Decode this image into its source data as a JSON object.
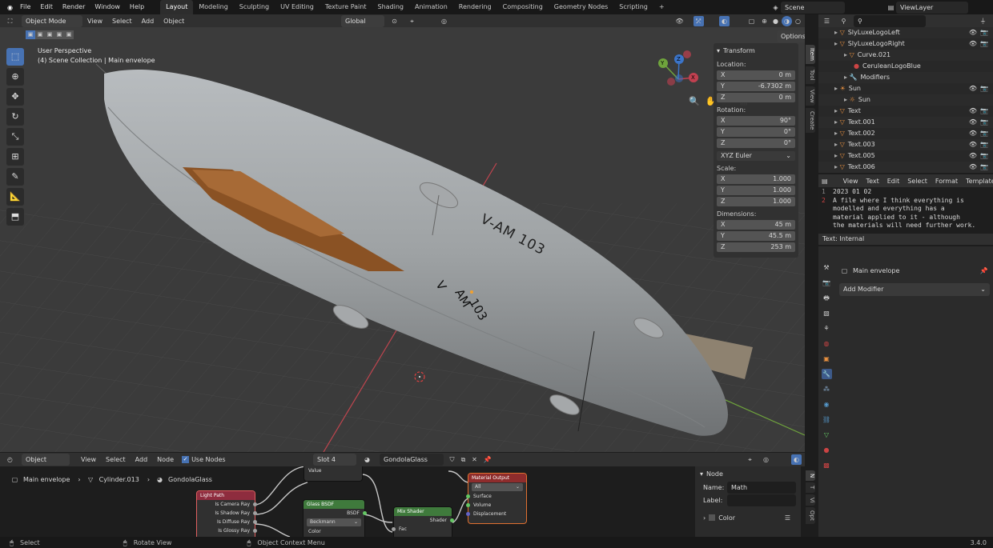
{
  "menu": {
    "items": [
      "File",
      "Edit",
      "Render",
      "Window",
      "Help"
    ],
    "workspaces": [
      "Layout",
      "Modeling",
      "Sculpting",
      "UV Editing",
      "Texture Paint",
      "Shading",
      "Animation",
      "Rendering",
      "Compositing",
      "Geometry Nodes",
      "Scripting"
    ],
    "active_workspace": "Layout",
    "add_tab": "+",
    "scene": "Scene",
    "view_layer": "ViewLayer"
  },
  "viewport_header": {
    "mode": "Object Mode",
    "menus": [
      "View",
      "Select",
      "Add",
      "Object"
    ],
    "orientation": "Global",
    "options": "Options"
  },
  "viewport": {
    "perspective": "User Perspective",
    "collection": "(4) Scene Collection | Main envelope",
    "hull_text_1": "V-AM 103",
    "hull_text_2_a": "V",
    "hull_text_2_b": "AM",
    "hull_text_2_c": "103",
    "gizmo": {
      "x": "X",
      "y": "Y",
      "z": "Z"
    }
  },
  "npanel": {
    "title": "Transform",
    "location_label": "Location:",
    "location": [
      {
        "axis": "X",
        "value": "0 m"
      },
      {
        "axis": "Y",
        "value": "-6.7302 m"
      },
      {
        "axis": "Z",
        "value": "0 m"
      }
    ],
    "rotation_label": "Rotation:",
    "rotation": [
      {
        "axis": "X",
        "value": "90°"
      },
      {
        "axis": "Y",
        "value": "0°"
      },
      {
        "axis": "Z",
        "value": "0°"
      }
    ],
    "rotation_mode": "XYZ Euler",
    "scale_label": "Scale:",
    "scale": [
      {
        "axis": "X",
        "value": "1.000"
      },
      {
        "axis": "Y",
        "value": "1.000"
      },
      {
        "axis": "Z",
        "value": "1.000"
      }
    ],
    "dimensions_label": "Dimensions:",
    "dimensions": [
      {
        "axis": "X",
        "value": "45 m"
      },
      {
        "axis": "Y",
        "value": "45.5 m"
      },
      {
        "axis": "Z",
        "value": "253 m"
      }
    ],
    "tabs": [
      "Item",
      "Tool",
      "View",
      "Create"
    ]
  },
  "outliner": {
    "rows": [
      {
        "label": "SlyLuxeLogoLeft",
        "indent": 1,
        "icon": "▽"
      },
      {
        "label": "SlyLuxeLogoRight",
        "indent": 1,
        "icon": "▽"
      },
      {
        "label": "Curve.021",
        "indent": 2,
        "icon": "▽"
      },
      {
        "label": "CeruleanLogoBlue",
        "indent": 3,
        "icon": "●"
      },
      {
        "label": "Modifiers",
        "indent": 2,
        "icon": "🔧"
      },
      {
        "label": "Sun",
        "indent": 1,
        "icon": "☀"
      },
      {
        "label": "Sun",
        "indent": 2,
        "icon": "☼"
      },
      {
        "label": "Text",
        "indent": 1,
        "icon": "▽"
      },
      {
        "label": "Text.001",
        "indent": 1,
        "icon": "▽"
      },
      {
        "label": "Text.002",
        "indent": 1,
        "icon": "▽"
      },
      {
        "label": "Text.003",
        "indent": 1,
        "icon": "▽"
      },
      {
        "label": "Text.005",
        "indent": 1,
        "icon": "▽"
      },
      {
        "label": "Text.006",
        "indent": 1,
        "icon": "▽"
      }
    ]
  },
  "text_editor": {
    "menus": [
      "View",
      "Text",
      "Edit",
      "Select",
      "Format",
      "Templates"
    ],
    "lines": [
      {
        "num": "1",
        "text": "2023 01 02"
      },
      {
        "num": "2",
        "text": "A file where I think everything is"
      },
      {
        "num": "",
        "text": "modelled and everything has a"
      },
      {
        "num": "",
        "text": "material applied to it - although"
      },
      {
        "num": "",
        "text": "the materials will need further work."
      }
    ],
    "footer": "Text: Internal"
  },
  "properties": {
    "object_name": "Main envelope",
    "add_modifier": "Add Modifier"
  },
  "node_editor": {
    "header": {
      "mode": "Object",
      "menus": [
        "View",
        "Select",
        "Add",
        "Node"
      ],
      "use_nodes": "Use Nodes",
      "slot": "Slot 4",
      "material": "GondolaGlass"
    },
    "breadcrumb": [
      "Main envelope",
      "Cylinder.013",
      "GondolaGlass"
    ],
    "nodes": {
      "value_out": "Value",
      "light_path": {
        "title": "Light Path",
        "outputs": [
          "Is Camera Ray",
          "Is Shadow Ray",
          "Is Diffuse Ray",
          "Is Glossy Ray"
        ]
      },
      "glass": {
        "title": "Glass BSDF",
        "output": "BSDF",
        "dist": "Beckmann",
        "color": "Color"
      },
      "mix": {
        "title": "Mix Shader",
        "output": "Shader",
        "fac": "Fac"
      },
      "output": {
        "title": "Material Output",
        "target": "All",
        "inputs": [
          "Surface",
          "Volume",
          "Displacement"
        ]
      }
    },
    "sidebar": {
      "title": "Node",
      "name_label": "Name:",
      "name": "Math",
      "label_label": "Label:",
      "color": "Color",
      "tabs": [
        "N",
        "T",
        "Vi",
        "Opt"
      ]
    }
  },
  "status": {
    "select": "Select",
    "rotate": "Rotate View",
    "context": "Object Context Menu",
    "version": "3.4.0"
  }
}
